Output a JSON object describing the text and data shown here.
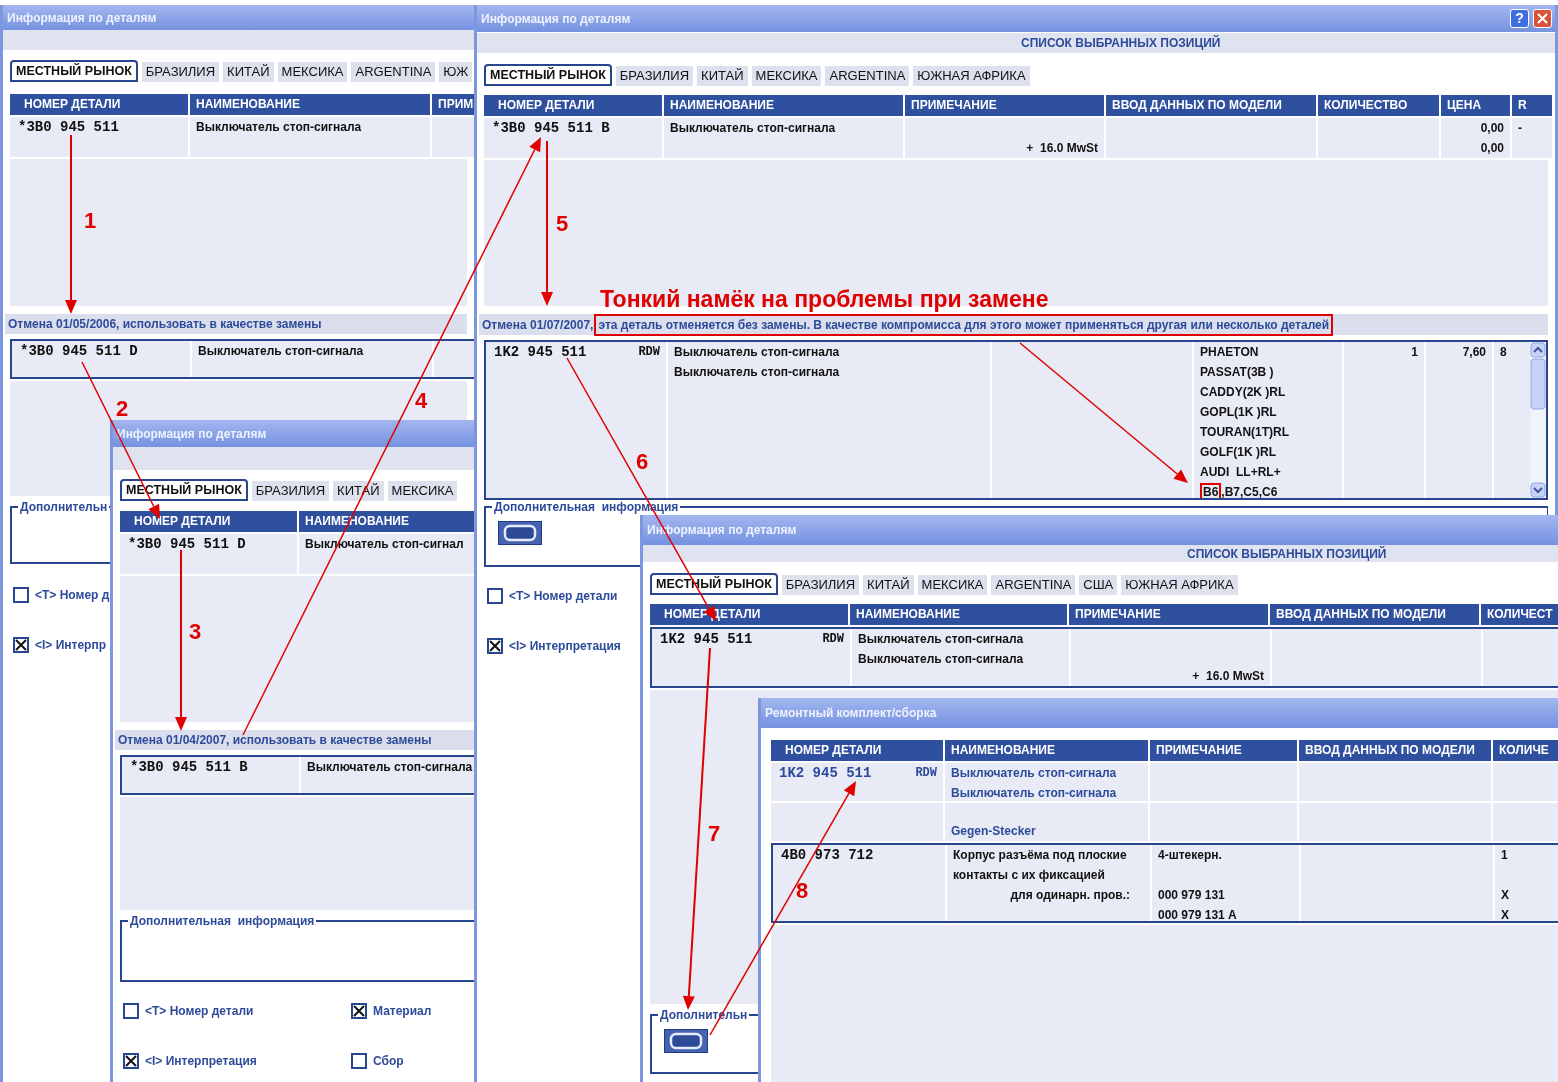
{
  "windows": [
    {
      "title": "Информация по деталям",
      "tabs": [
        {
          "label": "МЕСТНЫЙ РЫНОК",
          "selected": true
        },
        {
          "label": "БРАЗИЛИЯ",
          "selected": false
        },
        {
          "label": "КИТАЙ",
          "selected": false
        },
        {
          "label": "МЕКСИКА",
          "selected": false
        },
        {
          "label": "ARGENTINA",
          "selected": false
        },
        {
          "label": "ЮЖ",
          "selected": false
        }
      ],
      "columns": [
        "НОМЕР ДЕТАЛИ",
        "НАИМЕНОВАНИЕ",
        "ПРИМ"
      ],
      "rows": [
        {
          "kind": "plain",
          "part_number": "*3B0 945 511",
          "name": "Выключатель стоп-сигнала"
        }
      ],
      "note": [
        {
          "text": "Отмена 01/05/2006, использовать в качестве замены",
          "highlighted": false
        }
      ],
      "replacement_rows": [
        {
          "kind": "boxed",
          "part_number": "*3B0 945 511 D",
          "name": "Выключатель стоп-сигнала"
        }
      ],
      "info": {
        "label": "Дополнительн",
        "button": false
      },
      "checkboxes": [
        {
          "label": "<T> Номер д",
          "checked": false
        },
        {
          "label": "<I> Интерпр",
          "checked": true
        }
      ]
    },
    {
      "title": "Информация по деталям",
      "title_buttons": [
        {
          "kind": "help",
          "label": "?"
        },
        {
          "kind": "close"
        }
      ],
      "heading": "СПИСОК ВЫБРАННЫХ ПОЗИЦИЙ",
      "tabs": [
        {
          "label": "МЕСТНЫЙ РЫНОК",
          "selected": true
        },
        {
          "label": "БРАЗИЛИЯ",
          "selected": false
        },
        {
          "label": "КИТАЙ",
          "selected": false
        },
        {
          "label": "МЕКСИКА",
          "selected": false
        },
        {
          "label": "ARGENTINA",
          "selected": false
        },
        {
          "label": "ЮЖНАЯ АФРИКА",
          "selected": false
        }
      ],
      "columns": [
        "НОМЕР ДЕТАЛИ",
        "НАИМЕНОВАНИЕ",
        "ПРИМЕЧАНИЕ",
        "ВВОД ДАННЫХ ПО МОДЕЛИ",
        "КОЛИЧЕСТВО",
        "ЦЕНА",
        "R"
      ],
      "rows": [
        {
          "kind": "plain",
          "part_number": "*3B0 945 511 B",
          "name": "Выключатель стоп-сигнала",
          "remark": "+  16.0 MwSt",
          "price": "0,00\n0,00",
          "r": "-"
        }
      ],
      "note": [
        {
          "text": "Отмена 01/07/2007,",
          "highlighted": false
        },
        {
          "text": "эта деталь отменяется без замены. В качестве компромисса для этого может применяться другая или несколько деталей",
          "highlighted": true
        }
      ],
      "replacement_rows": [
        {
          "kind": "boxed",
          "part_number": "1K2 945 511",
          "suffix": "RDW",
          "name": "Выключатель стоп-сигнала\nВыключатель стоп-сигнала",
          "model_data": [
            "PHAETON",
            "PASSAT(3B )",
            "CADDY(2K )RL",
            "GOPL(1K )RL",
            "TOURAN(1T)RL",
            "GOLF(1K )RL",
            "AUDI  LL+RL+",
            [
              {
                "text": "B6",
                "highlighted": true
              },
              {
                "text": ",B7,C5,C6",
                "highlighted": false
              }
            ]
          ],
          "quantity": "1",
          "price": "7,60",
          "r": "8"
        }
      ],
      "info": {
        "label": "Дополнительная  информация",
        "button": true
      },
      "checkboxes": [
        {
          "label": "<T> Номер детали",
          "checked": false
        },
        {
          "label": "<I> Интерпретация",
          "checked": true
        }
      ]
    },
    {
      "title": "Информация по деталям",
      "tabs": [
        {
          "label": "МЕСТНЫЙ РЫНОК",
          "selected": true
        },
        {
          "label": "БРАЗИЛИЯ",
          "selected": false
        },
        {
          "label": "КИТАЙ",
          "selected": false
        },
        {
          "label": "МЕКСИКА",
          "selected": false
        }
      ],
      "columns": [
        "НОМЕР ДЕТАЛИ",
        "НАИМЕНОВАНИЕ"
      ],
      "rows": [
        {
          "kind": "plain",
          "part_number": "*3B0 945 511 D",
          "name": "Выключатель стоп-сигнал"
        }
      ],
      "note": [
        {
          "text": "Отмена 01/04/2007, использовать в качестве замены",
          "highlighted": false
        }
      ],
      "replacement_rows": [
        {
          "kind": "boxed",
          "part_number": "*3B0 945 511 B",
          "name": "Выключатель стоп-сигнала"
        }
      ],
      "info": {
        "label": "Дополнительная  информация",
        "button": false
      },
      "checkboxes": [
        {
          "label": "<T> Номер детали",
          "checked": false
        },
        {
          "label": "Материал",
          "checked": true
        },
        {
          "label": "<I> Интерпретация",
          "checked": true
        },
        {
          "label": "Сбор",
          "checked": false
        }
      ]
    },
    {
      "title": "Информация по деталям",
      "heading": "СПИСОК ВЫБРАННЫХ ПОЗИЦИЙ",
      "tabs": [
        {
          "label": "МЕСТНЫЙ РЫНОК",
          "selected": true
        },
        {
          "label": "БРАЗИЛИЯ",
          "selected": false
        },
        {
          "label": "КИТАЙ",
          "selected": false
        },
        {
          "label": "МЕКСИКА",
          "selected": false
        },
        {
          "label": "ARGENTINA",
          "selected": false
        },
        {
          "label": "США",
          "selected": false
        },
        {
          "label": "ЮЖНАЯ АФРИКА",
          "selected": false
        }
      ],
      "columns": [
        "НОМЕР ДЕТАЛИ",
        "НАИМЕНОВАНИЕ",
        "ПРИМЕЧАНИЕ",
        "ВВОД ДАННЫХ ПО МОДЕЛИ",
        "КОЛИЧЕСТ"
      ],
      "rows": [
        {
          "kind": "boxed",
          "part_number": "1K2 945 511",
          "suffix": "RDW",
          "name": "Выключатель стоп-сигнала\nВыключатель стоп-сигнала",
          "remark": "+  16.0 MwSt"
        }
      ],
      "info": {
        "label": "Дополнительн",
        "button": true
      }
    },
    {
      "title": "Ремонтный комплект/сборка",
      "columns": [
        "НОМЕР ДЕТАЛИ",
        "НАИМЕНОВАНИЕ",
        "ПРИМЕЧАНИЕ",
        "ВВОД ДАННЫХ ПО МОДЕЛИ",
        "КОЛИЧЕ"
      ],
      "rows": [
        {
          "kind": "group",
          "part_number": "1K2 945 511",
          "suffix": "RDW",
          "name": "Выключатель стоп-сигнала\nВыключатель стоп-сигнала"
        },
        {
          "kind": "subgroup",
          "name": "Gegen-Stecker"
        },
        {
          "kind": "component",
          "part_number": "4B0 973 712",
          "name": "Корпус разъёма под плоские\nконтакты с их фиксацией",
          "name_detail": "для одинарн. пров.:",
          "remark": "4-штекерн.\n\n000 979 131\n000 979 131 A",
          "quantity": "1\n\nX\nX"
        }
      ]
    }
  ],
  "annotations": {
    "steps": [
      {
        "label": "1"
      },
      {
        "label": "2"
      },
      {
        "label": "3"
      },
      {
        "label": "4"
      },
      {
        "label": "5"
      },
      {
        "label": "6"
      },
      {
        "label": "7"
      },
      {
        "label": "8"
      }
    ],
    "hint": "Тонкий намёк на проблемы при замене"
  }
}
